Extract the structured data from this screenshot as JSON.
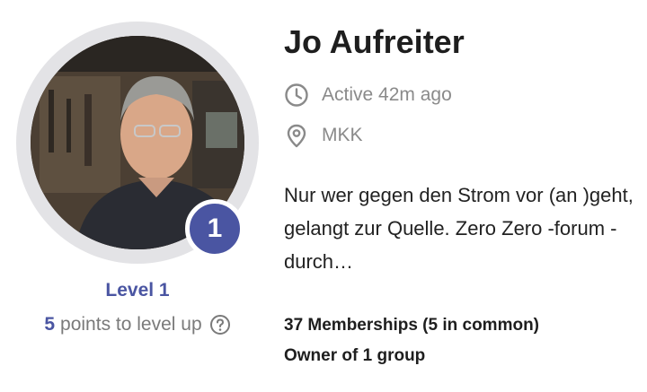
{
  "profile": {
    "name": "Jo Aufreiter",
    "avatar_icon": "profile-photo",
    "level_number": "1",
    "level_label": "Level 1",
    "points_needed": "5",
    "points_text": "points to level up",
    "active_text": "Active 42m ago",
    "location": "MKK",
    "bio": "Nur wer gegen den Strom vor (an )geht, gelangt zur Quelle. Zero Zero -forum - durch…",
    "memberships": "37 Memberships (5 in common)",
    "ownership": "Owner of 1 group"
  },
  "colors": {
    "accent": "#4a55a2",
    "muted_text": "#8a8a8a",
    "ring": "#e3e3e6"
  },
  "icons": {
    "active": "clock-icon",
    "location": "map-pin-icon",
    "help": "question-circle-icon"
  }
}
